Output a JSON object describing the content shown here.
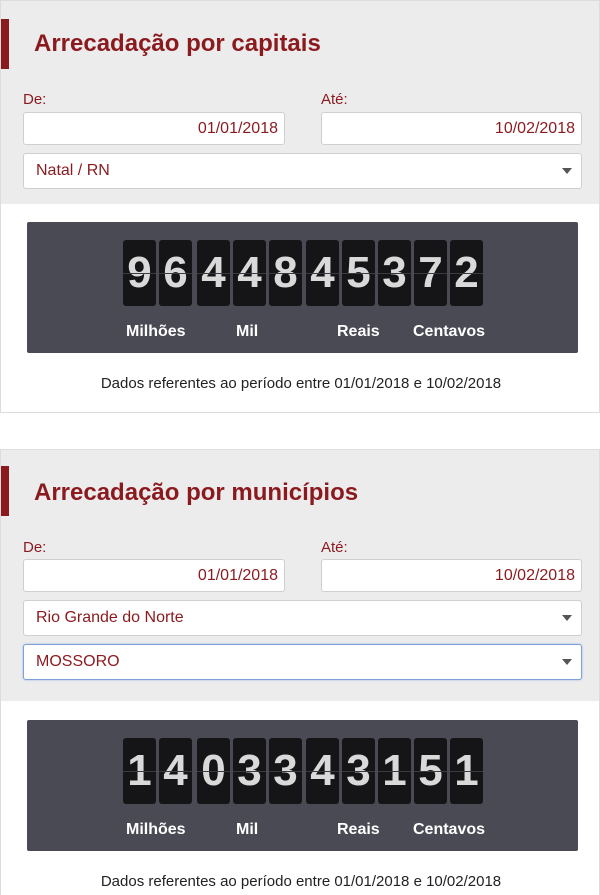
{
  "capitais": {
    "title": "Arrecadação por capitais",
    "de_label": "De:",
    "ate_label": "Até:",
    "de_value": "01/01/2018",
    "ate_value": "10/02/2018",
    "selects": [
      {
        "value": "Natal / RN"
      }
    ],
    "digits": [
      "9",
      "6",
      "4",
      "4",
      "8",
      "4",
      "5",
      "3",
      "7",
      "2"
    ],
    "units": [
      "Milhões",
      "Mil",
      "Reais",
      "Centavos"
    ],
    "footer": "Dados referentes ao período entre 01/01/2018 e 10/02/2018"
  },
  "municipios": {
    "title": "Arrecadação por municípios",
    "de_label": "De:",
    "ate_label": "Até:",
    "de_value": "01/01/2018",
    "ate_value": "10/02/2018",
    "selects": [
      {
        "value": "Rio Grande do Norte"
      },
      {
        "value": "MOSSORO"
      }
    ],
    "digits": [
      "1",
      "4",
      "0",
      "3",
      "3",
      "4",
      "3",
      "1",
      "5",
      "1"
    ],
    "units": [
      "Milhões",
      "Mil",
      "Reais",
      "Centavos"
    ],
    "footer": "Dados referentes ao período entre 01/01/2018 e 10/02/2018"
  },
  "icons": {
    "dropdown": "caret-down-icon"
  }
}
